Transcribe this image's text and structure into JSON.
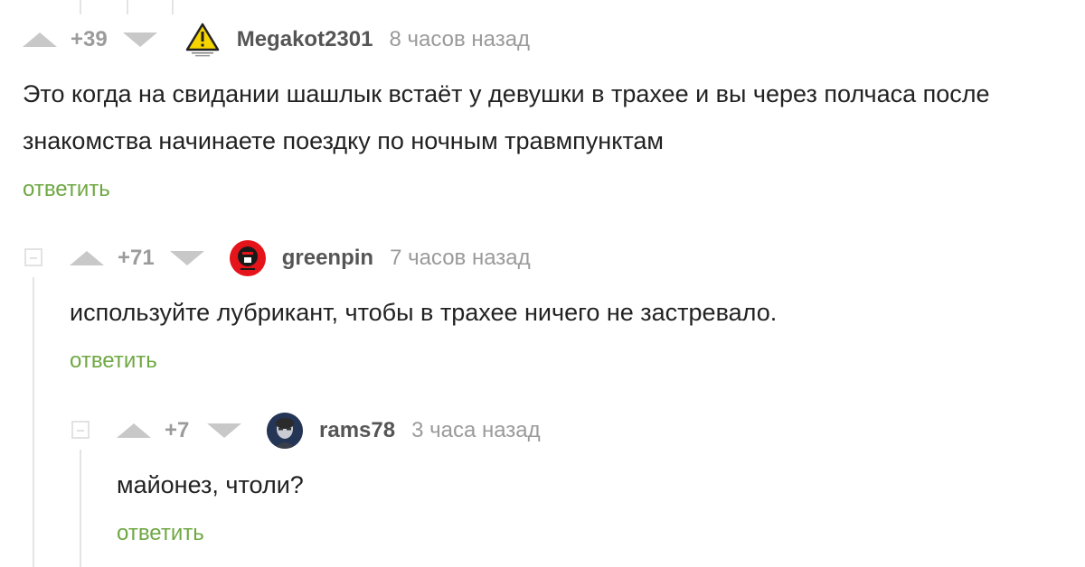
{
  "comments": [
    {
      "rating": "+39",
      "username": "Megakot2301",
      "time": "8 часов назад",
      "text": "Это когда на свидании шашлык встаёт у девушки в трахее и вы через полчаса после знакомства начинаете поездку по ночным травмпунктам",
      "reply": "ответить",
      "avatar_icon": "warning-triangle-icon"
    },
    {
      "rating": "+71",
      "username": "greenpin",
      "time": "7 часов назад",
      "text": "используйте лубрикант, чтобы в трахее ничего не застревало.",
      "reply": "ответить",
      "avatar_icon": "red-circle-avatar"
    },
    {
      "rating": "+7",
      "username": "rams78",
      "time": "3 часа назад",
      "text": "майонез, чтоли?",
      "reply": "ответить",
      "avatar_icon": "portrait-avatar"
    }
  ],
  "colors": {
    "reply_link": "#6fa843",
    "vote_arrow": "#c8c8c8",
    "meta_text": "#9a9a9a"
  }
}
